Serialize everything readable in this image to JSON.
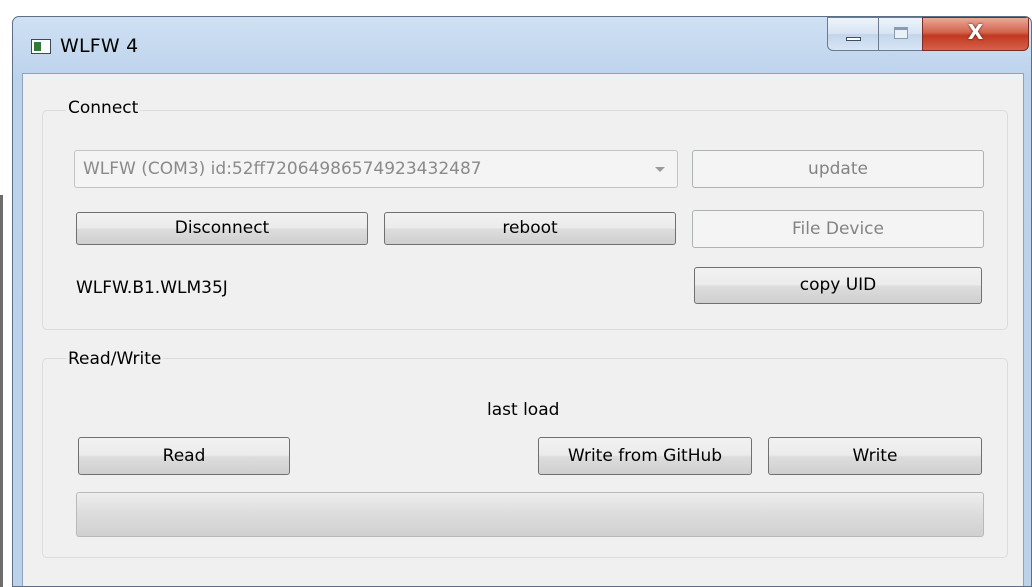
{
  "window": {
    "title": "WLFW 4",
    "icon": "app-window-icon",
    "close_glyph": "X"
  },
  "connect": {
    "group_title": "Connect",
    "device_select": {
      "value": "WLFW (COM3) id:52ff72064986574923432487",
      "enabled": false
    },
    "update_label": "update",
    "disconnect_label": "Disconnect",
    "reboot_label": "reboot",
    "file_device_label": "File Device",
    "firmware_label": "WLFW.B1.WLM35J",
    "copy_uid_label": "copy UID"
  },
  "read_write": {
    "group_title": "Read/Write",
    "status_label": "last load",
    "read_label": "Read",
    "write_github_label": "Write from GitHub",
    "write_label": "Write",
    "progress": 0
  },
  "colors": {
    "progress_fill": "#37b44a",
    "close_button": "#c0391f"
  }
}
